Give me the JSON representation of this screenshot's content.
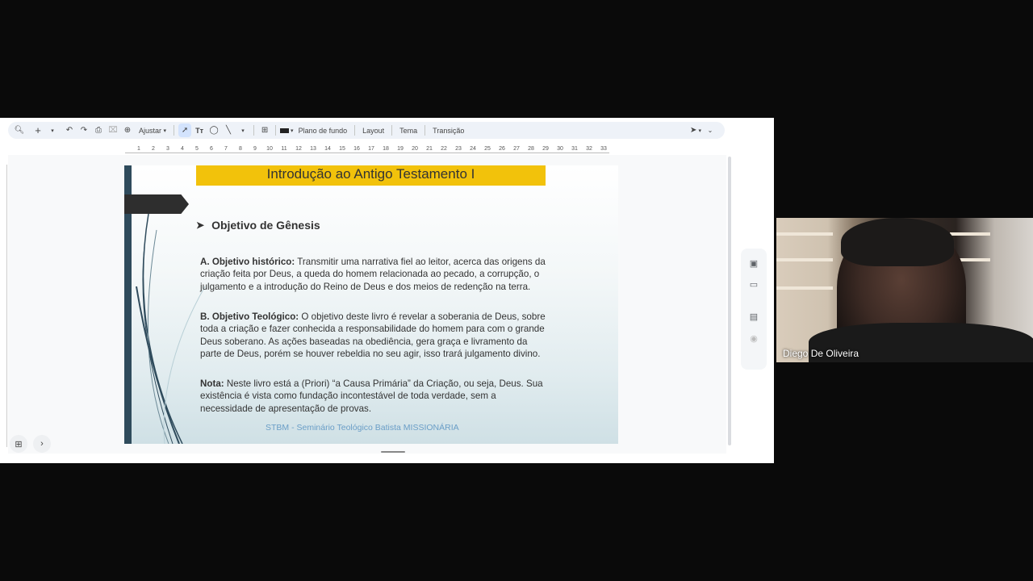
{
  "toolbar": {
    "zoom_label": "Ajustar",
    "background_label": "Plano de fundo",
    "layout_label": "Layout",
    "theme_label": "Tema",
    "transition_label": "Transição"
  },
  "ruler": {
    "marks": [
      "1",
      "2",
      "3",
      "4",
      "5",
      "6",
      "7",
      "8",
      "9",
      "10",
      "11",
      "12",
      "13",
      "14",
      "15",
      "16",
      "17",
      "18",
      "19",
      "20",
      "21",
      "22",
      "23",
      "24",
      "25",
      "26",
      "27",
      "28",
      "29",
      "30",
      "31",
      "32",
      "33"
    ]
  },
  "slide": {
    "title": "Introdução ao Antigo Testamento I",
    "subtitle": "Objetivo de Gênesis",
    "para1_label": "A. Objetivo histórico:",
    "para1_text": " Transmitir uma narrativa fiel ao leitor, acerca das origens da criação feita por Deus, a queda do homem relacionada ao pecado, a corrupção, o julgamento e a introdução do Reino de Deus e dos meios de redenção na terra.",
    "para2_label": "B. Objetivo Teológico:",
    "para2_text": " O objetivo deste livro é revelar a soberania de Deus, sobre toda a criação e fazer conhecida a responsabilidade do homem para com o grande Deus soberano. As ações baseadas na obediência, gera graça e livramento da parte de Deus, porém se houver rebeldia no seu agir, isso trará julgamento divino.",
    "para3_label": "Nota:",
    "para3_text": " Neste livro está a (Priori) “a Causa Primária” da Criação, ou seja, Deus. Sua existência é vista como fundação incontestável de toda verdade, sem a necessidade de apresentação de provas.",
    "footer": "STBM - Seminário Teológico Batista MISSIONÁRIA"
  },
  "participant": {
    "name": "Diego De Oliveira"
  },
  "colors": {
    "title_bg": "#f2c20b",
    "accent_bar": "#2f4b5c",
    "footer_text": "#6a9ec7"
  }
}
